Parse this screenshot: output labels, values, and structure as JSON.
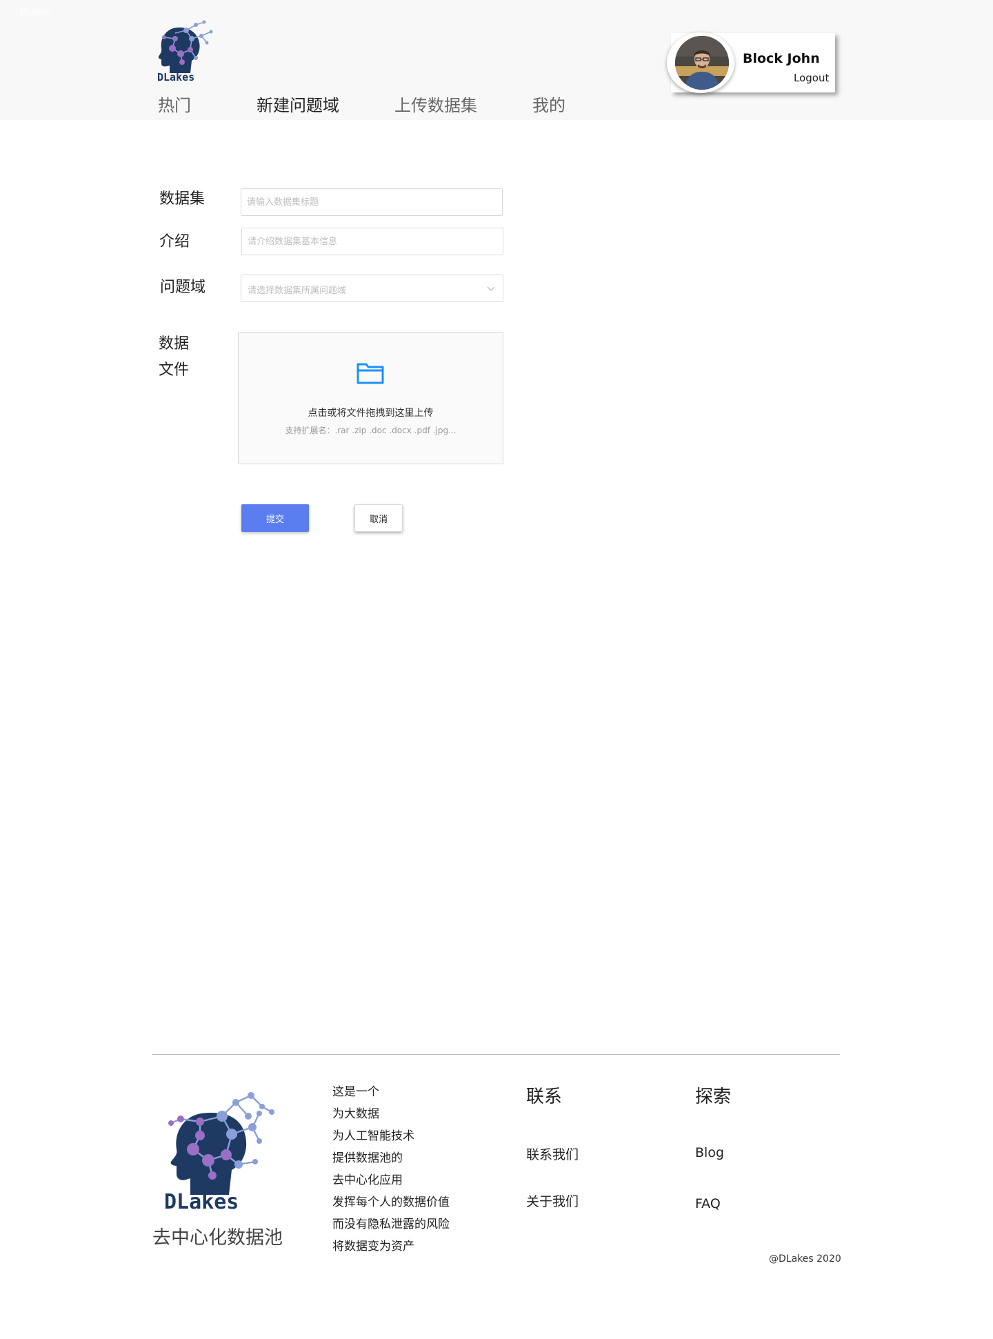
{
  "header": {
    "corner_mark": "DLakes",
    "logo_text": "DLakes",
    "nav": [
      {
        "label": "热门"
      },
      {
        "label": "新建问题域"
      },
      {
        "label": "上传数据集"
      },
      {
        "label": "我的"
      }
    ],
    "user": {
      "name": "Block John",
      "logout_label": "Logout"
    }
  },
  "form": {
    "dataset": {
      "label": "数据集",
      "placeholder": "请输入数据集标题",
      "value": ""
    },
    "intro": {
      "label": "介绍",
      "placeholder": "请介绍数据集基本信息",
      "value": ""
    },
    "domain": {
      "label": "问题域",
      "placeholder": "请选择数据集所属问题域"
    },
    "file": {
      "label_line1": "数据",
      "label_line2": "文件",
      "upload_text": "点击或将文件拖拽到这里上传",
      "upload_hint": "支持扩展名：.rar .zip .doc .docx .pdf .jpg..."
    },
    "submit_label": "提交",
    "cancel_label": "取消"
  },
  "footer": {
    "logo_text": "DLakes",
    "slogan": "去中心化数据池",
    "about_lines": [
      "这是一个",
      "为大数据",
      "为人工智能技术",
      "提供数据池的",
      "去中心化应用",
      "发挥每个人的数据价值",
      "而没有隐私泄露的风险",
      "将数据变为资产"
    ],
    "contact": {
      "title": "联系",
      "links": [
        "联系我们",
        "关于我们"
      ]
    },
    "explore": {
      "title": "探索",
      "links": [
        "Blog",
        "FAQ"
      ]
    },
    "copyright": "@DLakes 2020"
  },
  "colors": {
    "primary": "#5a7df0",
    "upload_icon": "#1e90ff",
    "logo_navy": "#1e3a63",
    "logo_node": "#8a9fd8",
    "logo_accent": "#9b6fc4"
  },
  "icons": {
    "upload": "folder-icon",
    "select_arrow": "chevron-down-icon"
  }
}
